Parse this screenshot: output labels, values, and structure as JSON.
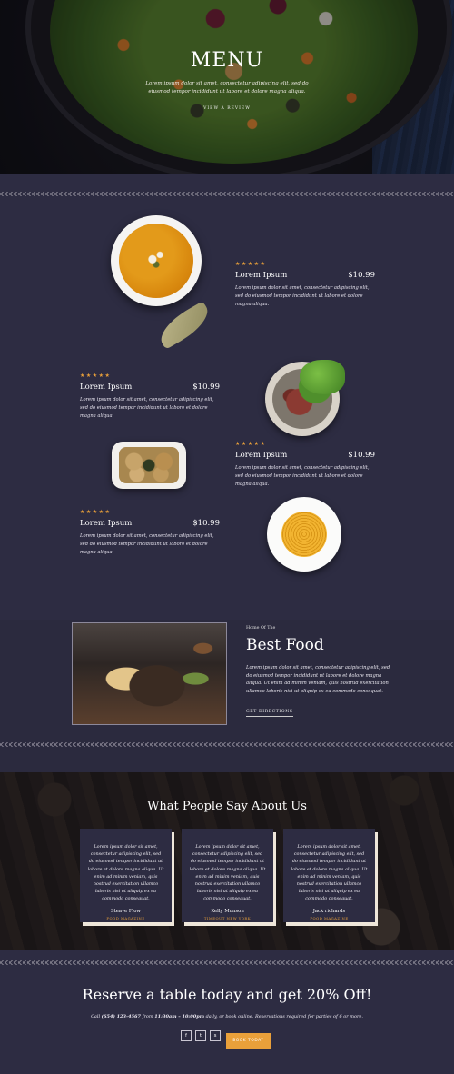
{
  "hero": {
    "title": "MENU",
    "text": "Lorem ipsum dolor sit amet, consectetur adipiscing elit, sed do eiusmod tempor incididunt ut labore et dolore magna aliqua.",
    "link": "VIEW A REVIEW"
  },
  "menu_items": [
    {
      "stars": "★★★★★",
      "name": "Lorem Ipsum",
      "price": "$10.99",
      "desc": "Lorem ipsum dolor sit amet, consectetur adipiscing elit, sed do eiusmod tempor incididunt ut labore et dolore magna aliqua."
    },
    {
      "stars": "★★★★★",
      "name": "Lorem Ipsum",
      "price": "$10.99",
      "desc": "Lorem ipsum dolor sit amet, consectetur adipiscing elit, sed do eiusmod tempor incididunt ut labore et dolore magna aliqua."
    },
    {
      "stars": "★★★★★",
      "name": "Lorem Ipsum",
      "price": "$10.99",
      "desc": "Lorem ipsum dolor sit amet, consectetur adipiscing elit, sed do eiusmod tempor incididunt ut labore et dolore magna aliqua."
    },
    {
      "stars": "★★★★★",
      "name": "Lorem Ipsum",
      "price": "$10.99",
      "desc": "Lorem ipsum dolor sit amet, consectetur adipiscing elit, sed do eiusmod tempor incididunt ut labore et dolore magna aliqua."
    }
  ],
  "about": {
    "kicker": "Home Of The",
    "title": "Best Food",
    "text": "Lorem ipsum dolor sit amet, consectetur adipiscing elit, sed do eiusmod tempor incididunt ut labore et dolore magna aliqua. Ut enim ad minim veniam, quis nostrud exercitation ullamco laboris nisi ut aliquip ex ea commodo consequat.",
    "link": "GET DIRECTIONS"
  },
  "testimonials": {
    "title": "What People Say About Us",
    "cards": [
      {
        "quote": "Lorem ipsum dolor sit amet, consectetur adipiscing elit, sed do eiusmod tempor incididunt ut labore et dolore magna aliqua. Ut enim ad minim veniam, quis nostrud exercitation ullamco laboris nisi ut aliquip ex ea commodo consequat.",
        "name": "Steave Flow",
        "role": "FOOD MAGAZINE"
      },
      {
        "quote": "Lorem ipsum dolor sit amet, consectetur adipiscing elit, sed do eiusmod tempor incididunt ut labore et dolore magna aliqua. Ut enim ad minim veniam, quis nostrud exercitation ullamco laboris nisi ut aliquip ex ea commodo consequat.",
        "name": "Kelly Munson",
        "role": "TIMEOUT NEW YORK"
      },
      {
        "quote": "Lorem ipsum dolor sit amet, consectetur adipiscing elit, sed do eiusmod tempor incididunt ut labore et dolore magna aliqua. Ut enim ad minim veniam, quis nostrud exercitation ullamco laboris nisi ut aliquip ex ea commodo consequat.",
        "name": "Jack richards",
        "role": "FOOD MAGAZINE"
      }
    ]
  },
  "reserve": {
    "title": "Reserve a table today and get 20% Off!",
    "text_prefix": "Call ",
    "phone": "(654) 123-4567",
    "text_mid": " from ",
    "hours": "11:30am – 10:00pm",
    "text_suffix": " daily, or book online. Reservations required for parties of 6 or more.",
    "social": [
      {
        "icon": "facebook-icon",
        "glyph": "f"
      },
      {
        "icon": "twitter-icon",
        "glyph": "t"
      },
      {
        "icon": "skype-icon",
        "glyph": "s"
      }
    ],
    "button": "BOOK TODAY"
  },
  "colors": {
    "accent": "#e9a03a",
    "background": "#2d2c42",
    "card_shadow": "#efe7da"
  }
}
